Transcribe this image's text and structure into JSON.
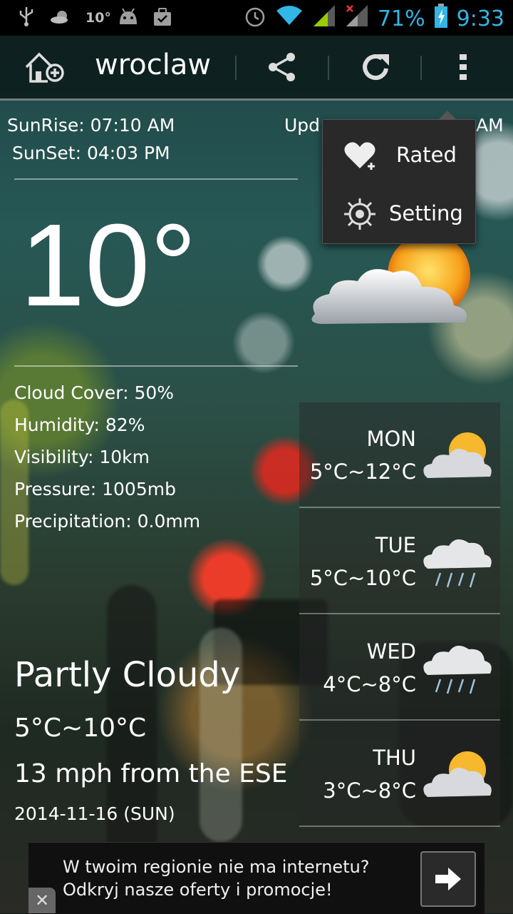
{
  "status_bar": {
    "notif_temp": "10°",
    "battery": "71%",
    "time": "9:33",
    "icons": [
      "usb-icon",
      "weather-notification-icon",
      "temp-notification-icon",
      "android-icon",
      "briefcase-icon",
      "alarm-icon",
      "wifi-icon",
      "signal-icon",
      "signal-no-data-icon",
      "battery-charging-icon"
    ]
  },
  "action_bar": {
    "title": "wroclaw",
    "icons": [
      "add-city-icon",
      "share-icon",
      "refresh-icon",
      "overflow-menu-icon"
    ]
  },
  "sun": {
    "sunrise": "SunRise: 07:10 AM",
    "sunset": "SunSet: 04:03 PM",
    "updated_left": "Upd",
    "updated_right": "AM"
  },
  "current": {
    "temperature": "10°",
    "icon": "partly-cloudy-icon",
    "details": [
      "Cloud Cover: 50%",
      "Humidity: 82%",
      "Visibility: 10km",
      "Pressure: 1005mb",
      "Precipitation: 0.0mm"
    ],
    "condition": "Partly Cloudy",
    "range": "5°C~10°C",
    "wind": "13 mph from the ESE",
    "date": "2014-11-16 (SUN)"
  },
  "forecast": [
    {
      "day": "MON",
      "temps": "5°C~12°C",
      "icon": "partly-cloudy-icon"
    },
    {
      "day": "TUE",
      "temps": "5°C~10°C",
      "icon": "rain-cloud-icon"
    },
    {
      "day": "WED",
      "temps": "4°C~8°C",
      "icon": "rain-cloud-icon"
    },
    {
      "day": "THU",
      "temps": "3°C~8°C",
      "icon": "partly-cloudy-icon"
    }
  ],
  "menu": {
    "items": [
      {
        "label": "Rated",
        "icon": "heart-icon"
      },
      {
        "label": "Setting",
        "icon": "gear-icon"
      }
    ]
  },
  "ad": {
    "line1": "W twoim regionie nie ma internetu?",
    "line2": "Odkryj nasze oferty i promocje!",
    "close": "✕",
    "icons": [
      "arrow-right-icon",
      "close-icon"
    ]
  }
}
